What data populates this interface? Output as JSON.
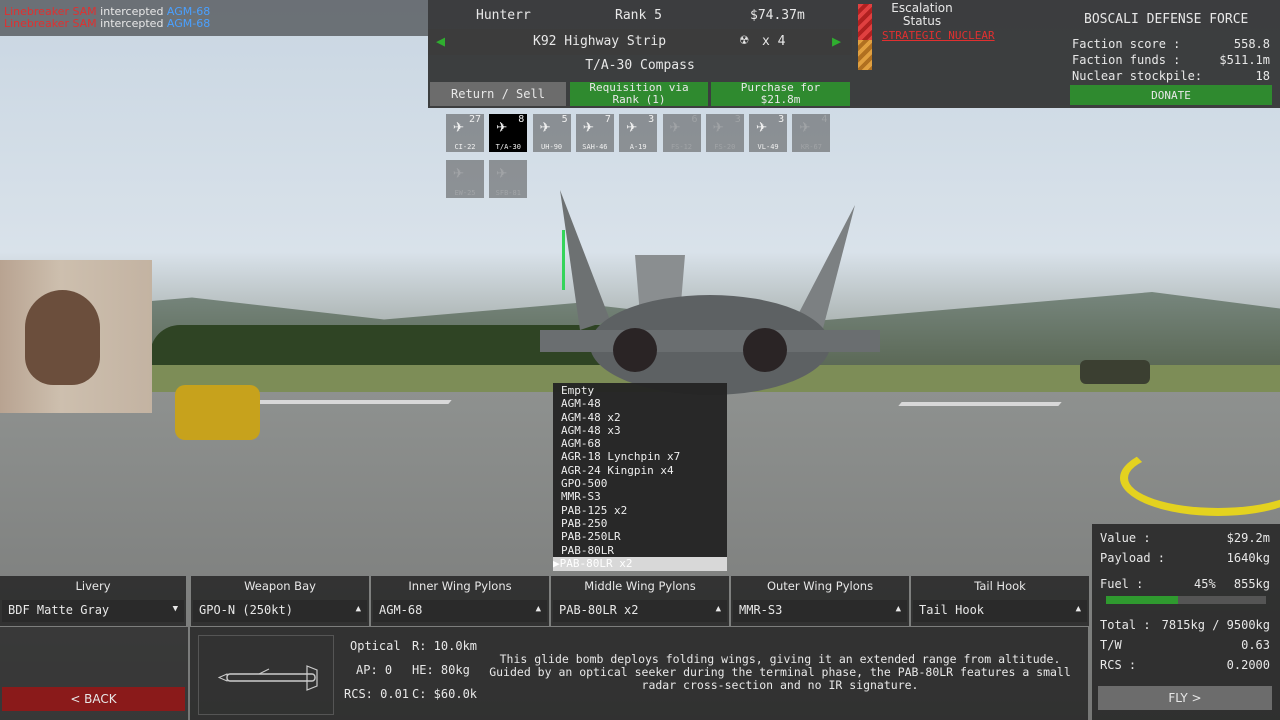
{
  "killfeed": [
    {
      "attacker": "Linebreaker SAM",
      "verb": "intercepted",
      "target": "AGM-68"
    },
    {
      "attacker": "Linebreaker SAM",
      "verb": "intercepted",
      "target": "AGM-68"
    }
  ],
  "player": {
    "name": "Hunterr",
    "rank": "Rank 5",
    "funds": "$74.37m"
  },
  "airbase": {
    "name": "K92 Highway Strip",
    "nukes": "x 4"
  },
  "aircraft_name": "T/A-30 Compass",
  "actions": {
    "return_sell": "Return / Sell",
    "requisition": "Requisition via Rank (1)",
    "purchase": "Purchase for $21.8m"
  },
  "escalation": {
    "title": "Escalation Status",
    "level": "STRATEGIC NUCLEAR"
  },
  "faction": {
    "name": "BOSCALI DEFENSE FORCE",
    "score_label": "Faction score :",
    "score": "558.8",
    "funds_label": "Faction funds :",
    "funds": "$511.1m",
    "nukes_label": "Nuclear stockpile:",
    "nukes": "18",
    "donate": "DONATE"
  },
  "aircraft_tiles": [
    {
      "label": "CI-22",
      "count": "27",
      "state": "normal"
    },
    {
      "label": "T/A-30",
      "count": "8",
      "state": "selected"
    },
    {
      "label": "UH-90",
      "count": "5",
      "state": "normal"
    },
    {
      "label": "SAH-46",
      "count": "7",
      "state": "normal"
    },
    {
      "label": "A-19",
      "count": "3",
      "state": "normal"
    },
    {
      "label": "FS-12",
      "count": "6",
      "state": "disabled"
    },
    {
      "label": "FS-20",
      "count": "3",
      "state": "disabled"
    },
    {
      "label": "VL-49",
      "count": "3",
      "state": "normal"
    },
    {
      "label": "KR-67",
      "count": "4",
      "state": "disabled"
    },
    {
      "label": "EW-25",
      "count": "",
      "state": "disabled"
    },
    {
      "label": "SFB-81",
      "count": "",
      "state": "disabled"
    }
  ],
  "dropdown": {
    "options": [
      "Empty",
      "AGM-48",
      "AGM-48 x2",
      "AGM-48 x3",
      "AGM-68",
      "AGR-18 Lynchpin x7",
      "AGR-24 Kingpin x4",
      "GPO-500",
      "MMR-S3",
      "PAB-125 x2",
      "PAB-250",
      "PAB-250LR",
      "PAB-80LR"
    ],
    "selected": "PAB-80LR x2"
  },
  "loadout": [
    {
      "header": "Livery",
      "value": "BDF Matte Gray",
      "arrow": "▼"
    },
    {
      "header": "Weapon Bay",
      "value": "GPO-N (250kt)",
      "arrow": "▲"
    },
    {
      "header": "Inner Wing Pylons",
      "value": "AGM-68",
      "arrow": "▲"
    },
    {
      "header": "Middle Wing Pylons",
      "value": "PAB-80LR x2",
      "arrow": "▲"
    },
    {
      "header": "Outer Wing Pylons",
      "value": "MMR-S3",
      "arrow": "▲"
    },
    {
      "header": "Tail Hook",
      "value": "Tail Hook",
      "arrow": "▲"
    }
  ],
  "weapon": {
    "seeker": "Optical",
    "range": "R: 10.0km",
    "ap": "AP: 0",
    "he": "HE: 80kg",
    "rcs": "RCS: 0.01",
    "cost": "C: $60.0k",
    "description": "This glide bomb deploys folding wings, giving it an extended range from altitude. Guided by an optical seeker during the terminal phase, the PAB-80LR features a small radar cross-section and no IR signature."
  },
  "back_label": "< BACK",
  "stats": {
    "value_label": "Value :",
    "value": "$29.2m",
    "payload_label": "Payload :",
    "payload": "1640kg",
    "fuel_label": "Fuel :",
    "fuel_pct": "45%",
    "fuel_kg": "855kg",
    "fuel_fraction": 0.45,
    "total_label": "Total :",
    "total": "7815kg / 9500kg",
    "tw_label": "T/W",
    "tw": "0.63",
    "rcs_label": "RCS :",
    "rcs": "0.2000",
    "fly": "FLY >"
  },
  "colors": {
    "green": "#2f8a2f",
    "red": "#e03030",
    "blue": "#4aa0ff",
    "back_red": "#8a1a1a"
  }
}
